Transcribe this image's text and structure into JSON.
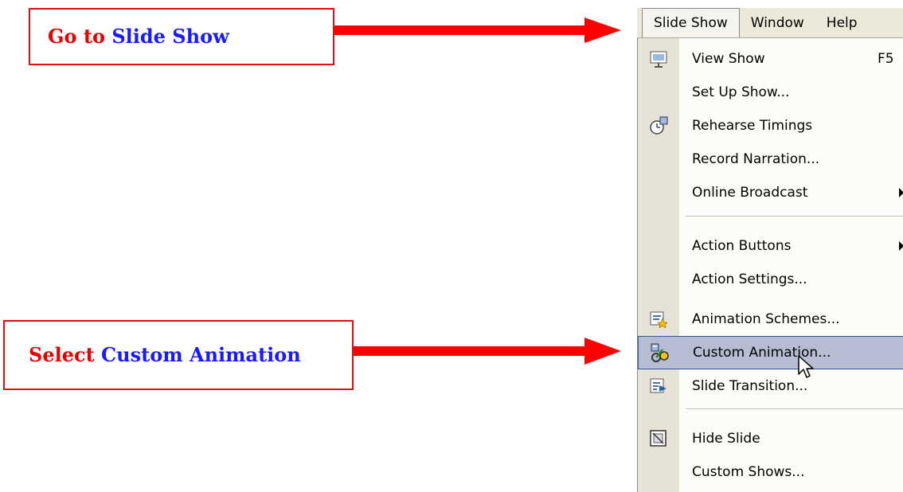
{
  "callouts": [
    {
      "prefix": "Go to",
      "highlight": "Slide Show"
    },
    {
      "prefix": "Select",
      "highlight": "Custom Animation"
    }
  ],
  "menubar": {
    "items": [
      "Slide Show",
      "Window",
      "Help"
    ],
    "active": "Slide Show"
  },
  "menu": {
    "items": [
      {
        "label": "View Show",
        "shortcut": "F5",
        "icon": "view-show-icon"
      },
      {
        "label": "Set Up Show...",
        "icon": ""
      },
      {
        "label": "Rehearse Timings",
        "icon": "rehearse-timings-icon"
      },
      {
        "label": "Record Narration...",
        "icon": ""
      },
      {
        "label": "Online Broadcast",
        "submenu": true,
        "icon": ""
      },
      {
        "label": "Action Buttons",
        "submenu": true,
        "icon": ""
      },
      {
        "label": "Action Settings...",
        "icon": ""
      },
      {
        "label": "Animation Schemes...",
        "icon": "animation-schemes-icon"
      },
      {
        "label": "Custom Animation...",
        "icon": "custom-animation-icon",
        "highlighted": true
      },
      {
        "label": "Slide Transition...",
        "icon": "slide-transition-icon"
      },
      {
        "label": "Hide Slide",
        "icon": "hide-slide-icon"
      },
      {
        "label": "Custom Shows...",
        "icon": ""
      }
    ]
  },
  "colors": {
    "callout_red": "#e80000",
    "callout_blue": "#1a1aff",
    "arrow": "#ff0000",
    "highlight_fill": "#b6bdd2",
    "highlight_border": "#31569a"
  }
}
